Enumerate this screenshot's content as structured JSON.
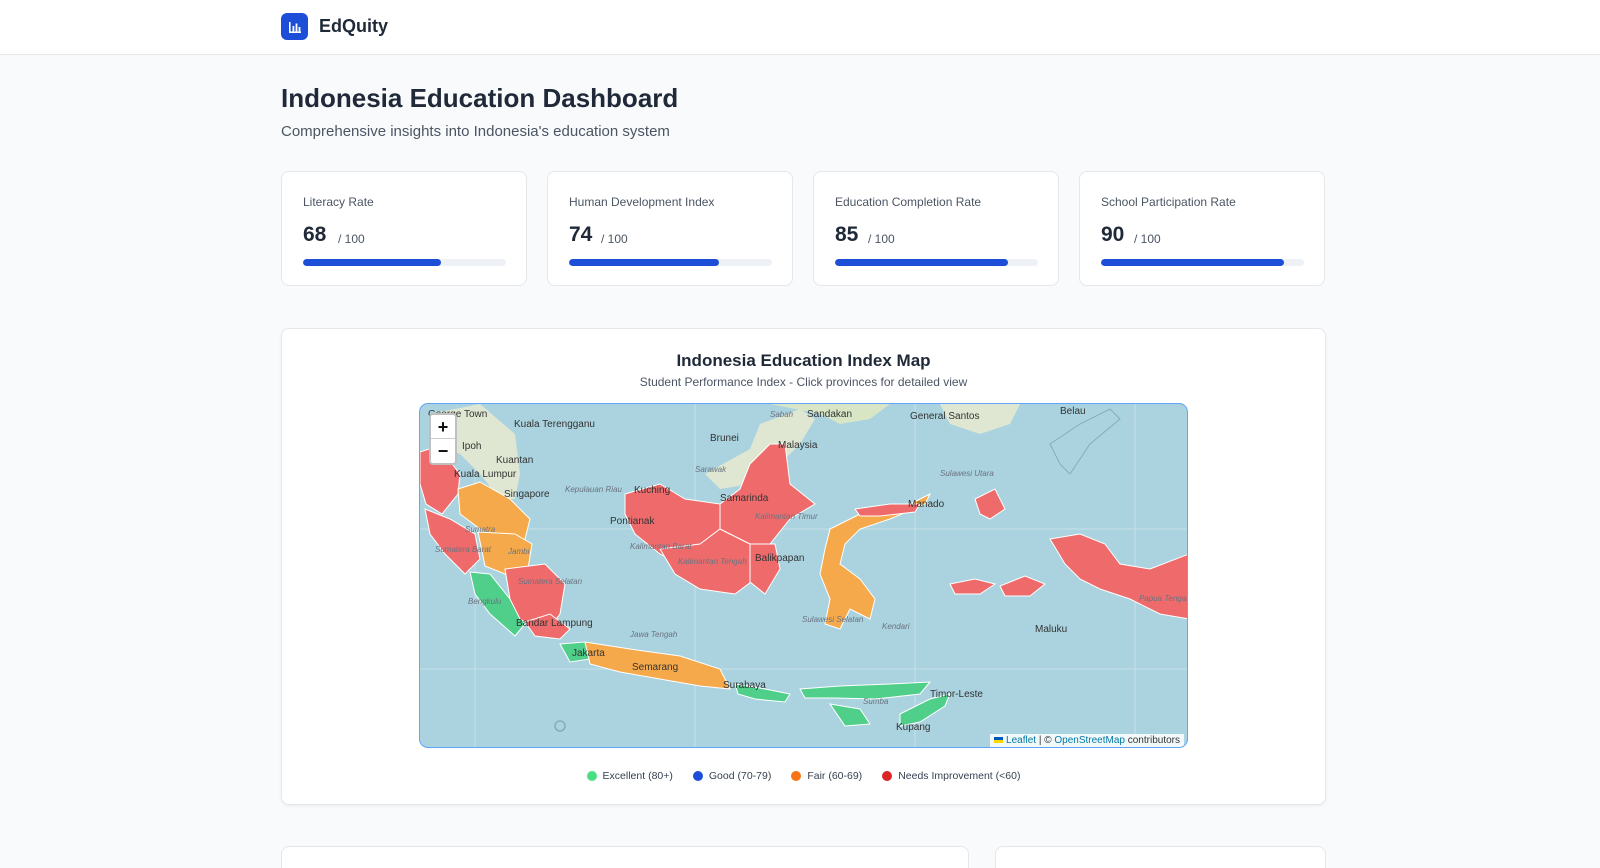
{
  "brand": {
    "name": "EdQuity",
    "icon": "bar-chart-icon",
    "color": "#1d4ed8"
  },
  "header": {
    "title": "Indonesia Education Dashboard",
    "subtitle": "Comprehensive insights into Indonesia's education system"
  },
  "stats": [
    {
      "label": "Literacy Rate",
      "value": "68",
      "unit": "/ 100",
      "progress": 0.68
    },
    {
      "label": "Human Development Index",
      "value": "74",
      "unit": "/ 100",
      "progress": 0.74
    },
    {
      "label": "Education Completion Rate",
      "value": "85",
      "unit": "/ 100",
      "progress": 0.85
    },
    {
      "label": "School Participation Rate",
      "value": "90",
      "unit": "/ 100",
      "progress": 0.9
    }
  ],
  "map": {
    "title": "Indonesia Education Index Map",
    "subtitle": "Student Performance Index - Click provinces for detailed view",
    "zoom_in": "+",
    "zoom_out": "−",
    "attribution": {
      "leaflet": "Leaflet",
      "separator": "| ©",
      "osm": "OpenStreetMap",
      "contributors": "contributors"
    },
    "places": [
      "George Town",
      "Kuala Terengganu",
      "Ipoh",
      "Kuantan",
      "Kuala Lumpur",
      "Singapore",
      "Brunei",
      "Malaysia",
      "Sabah",
      "Sandakan",
      "General Santos",
      "Belau",
      "Sarawak",
      "Kuching",
      "Pontianak",
      "Samarinda",
      "Balikpapan",
      "Manado",
      "Sulawesi Utara",
      "Sumatra",
      "Jambi",
      "Sumatera Barat",
      "Sumatera Selatan",
      "Bengkulu",
      "Bandar Lampung",
      "Jakarta",
      "Semarang",
      "Jawa Tengah",
      "Surabaya",
      "Kalimantan Tengah",
      "Kalimantan Timur",
      "Sulawesi Selatan",
      "Kendari",
      "Maluku",
      "Timor-Leste",
      "Sumba",
      "Kupang",
      "Papua Tengah",
      "Kepulauan Riau",
      "Kalimantan Barat"
    ],
    "colors": {
      "excellent": "#4ade80",
      "good": "#1d4ed8",
      "fair": "#f59e0b",
      "needs_improvement": "#ef4444",
      "sea": "#aad3df"
    }
  },
  "legend": [
    {
      "label": "Excellent (80+)",
      "color": "#4ade80"
    },
    {
      "label": "Good (70-79)",
      "color": "#1d4ed8"
    },
    {
      "label": "Fair (60-69)",
      "color": "#f97316"
    },
    {
      "label": "Needs Improvement (<60)",
      "color": "#dc2626"
    }
  ]
}
